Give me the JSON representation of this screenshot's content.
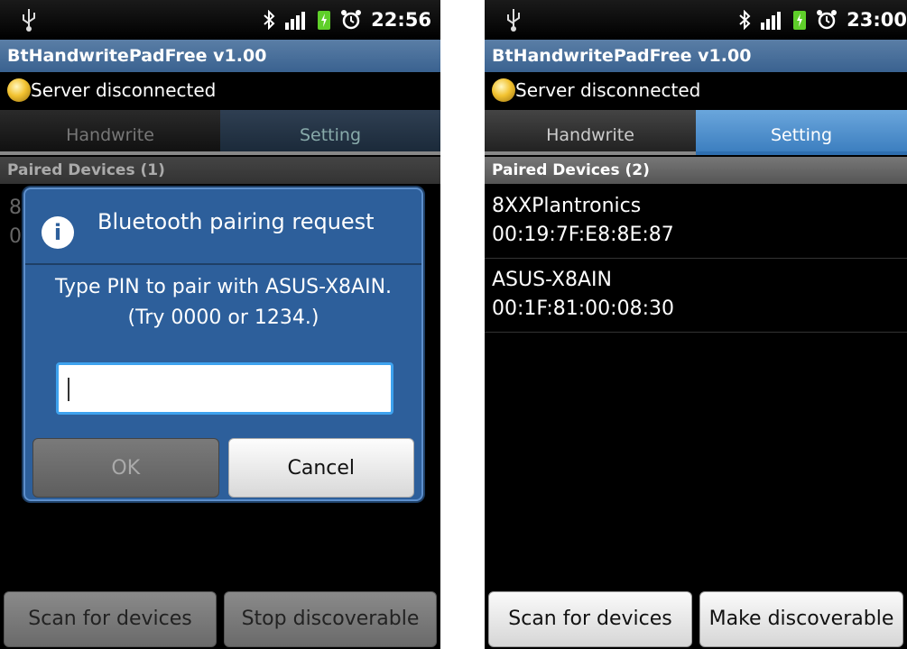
{
  "left": {
    "status": {
      "time": "22:56"
    },
    "app_title": "BtHandwritePadFree v1.00",
    "server_status": "Server disconnected",
    "tabs": [
      {
        "label": "Handwrite"
      },
      {
        "label": "Setting"
      }
    ],
    "paired_header": "Paired Devices (1)",
    "partial_device_text": "8\n0",
    "dialog": {
      "title": "Bluetooth pairing request",
      "message": "Type PIN to pair with ASUS-X8AIN. (Try 0000 or 1234.)",
      "pin_value": "",
      "ok_label": "OK",
      "cancel_label": "Cancel"
    },
    "buttons": {
      "scan": "Scan for devices",
      "stop": "Stop discoverable"
    }
  },
  "right": {
    "status": {
      "time": "23:00"
    },
    "app_title": "BtHandwritePadFree v1.00",
    "server_status": "Server disconnected",
    "tabs": [
      {
        "label": "Handwrite"
      },
      {
        "label": "Setting"
      }
    ],
    "paired_header": "Paired Devices (2)",
    "devices": [
      {
        "name": "8XXPlantronics",
        "mac": "00:19:7F:E8:8E:87"
      },
      {
        "name": "ASUS-X8AIN",
        "mac": "00:1F:81:00:08:30"
      }
    ],
    "buttons": {
      "scan": "Scan for devices",
      "make": "Make discoverable"
    }
  },
  "colors": {
    "accent": "#3d7fc0",
    "dialog": "#2d5f9b",
    "led": "#f2c230"
  }
}
